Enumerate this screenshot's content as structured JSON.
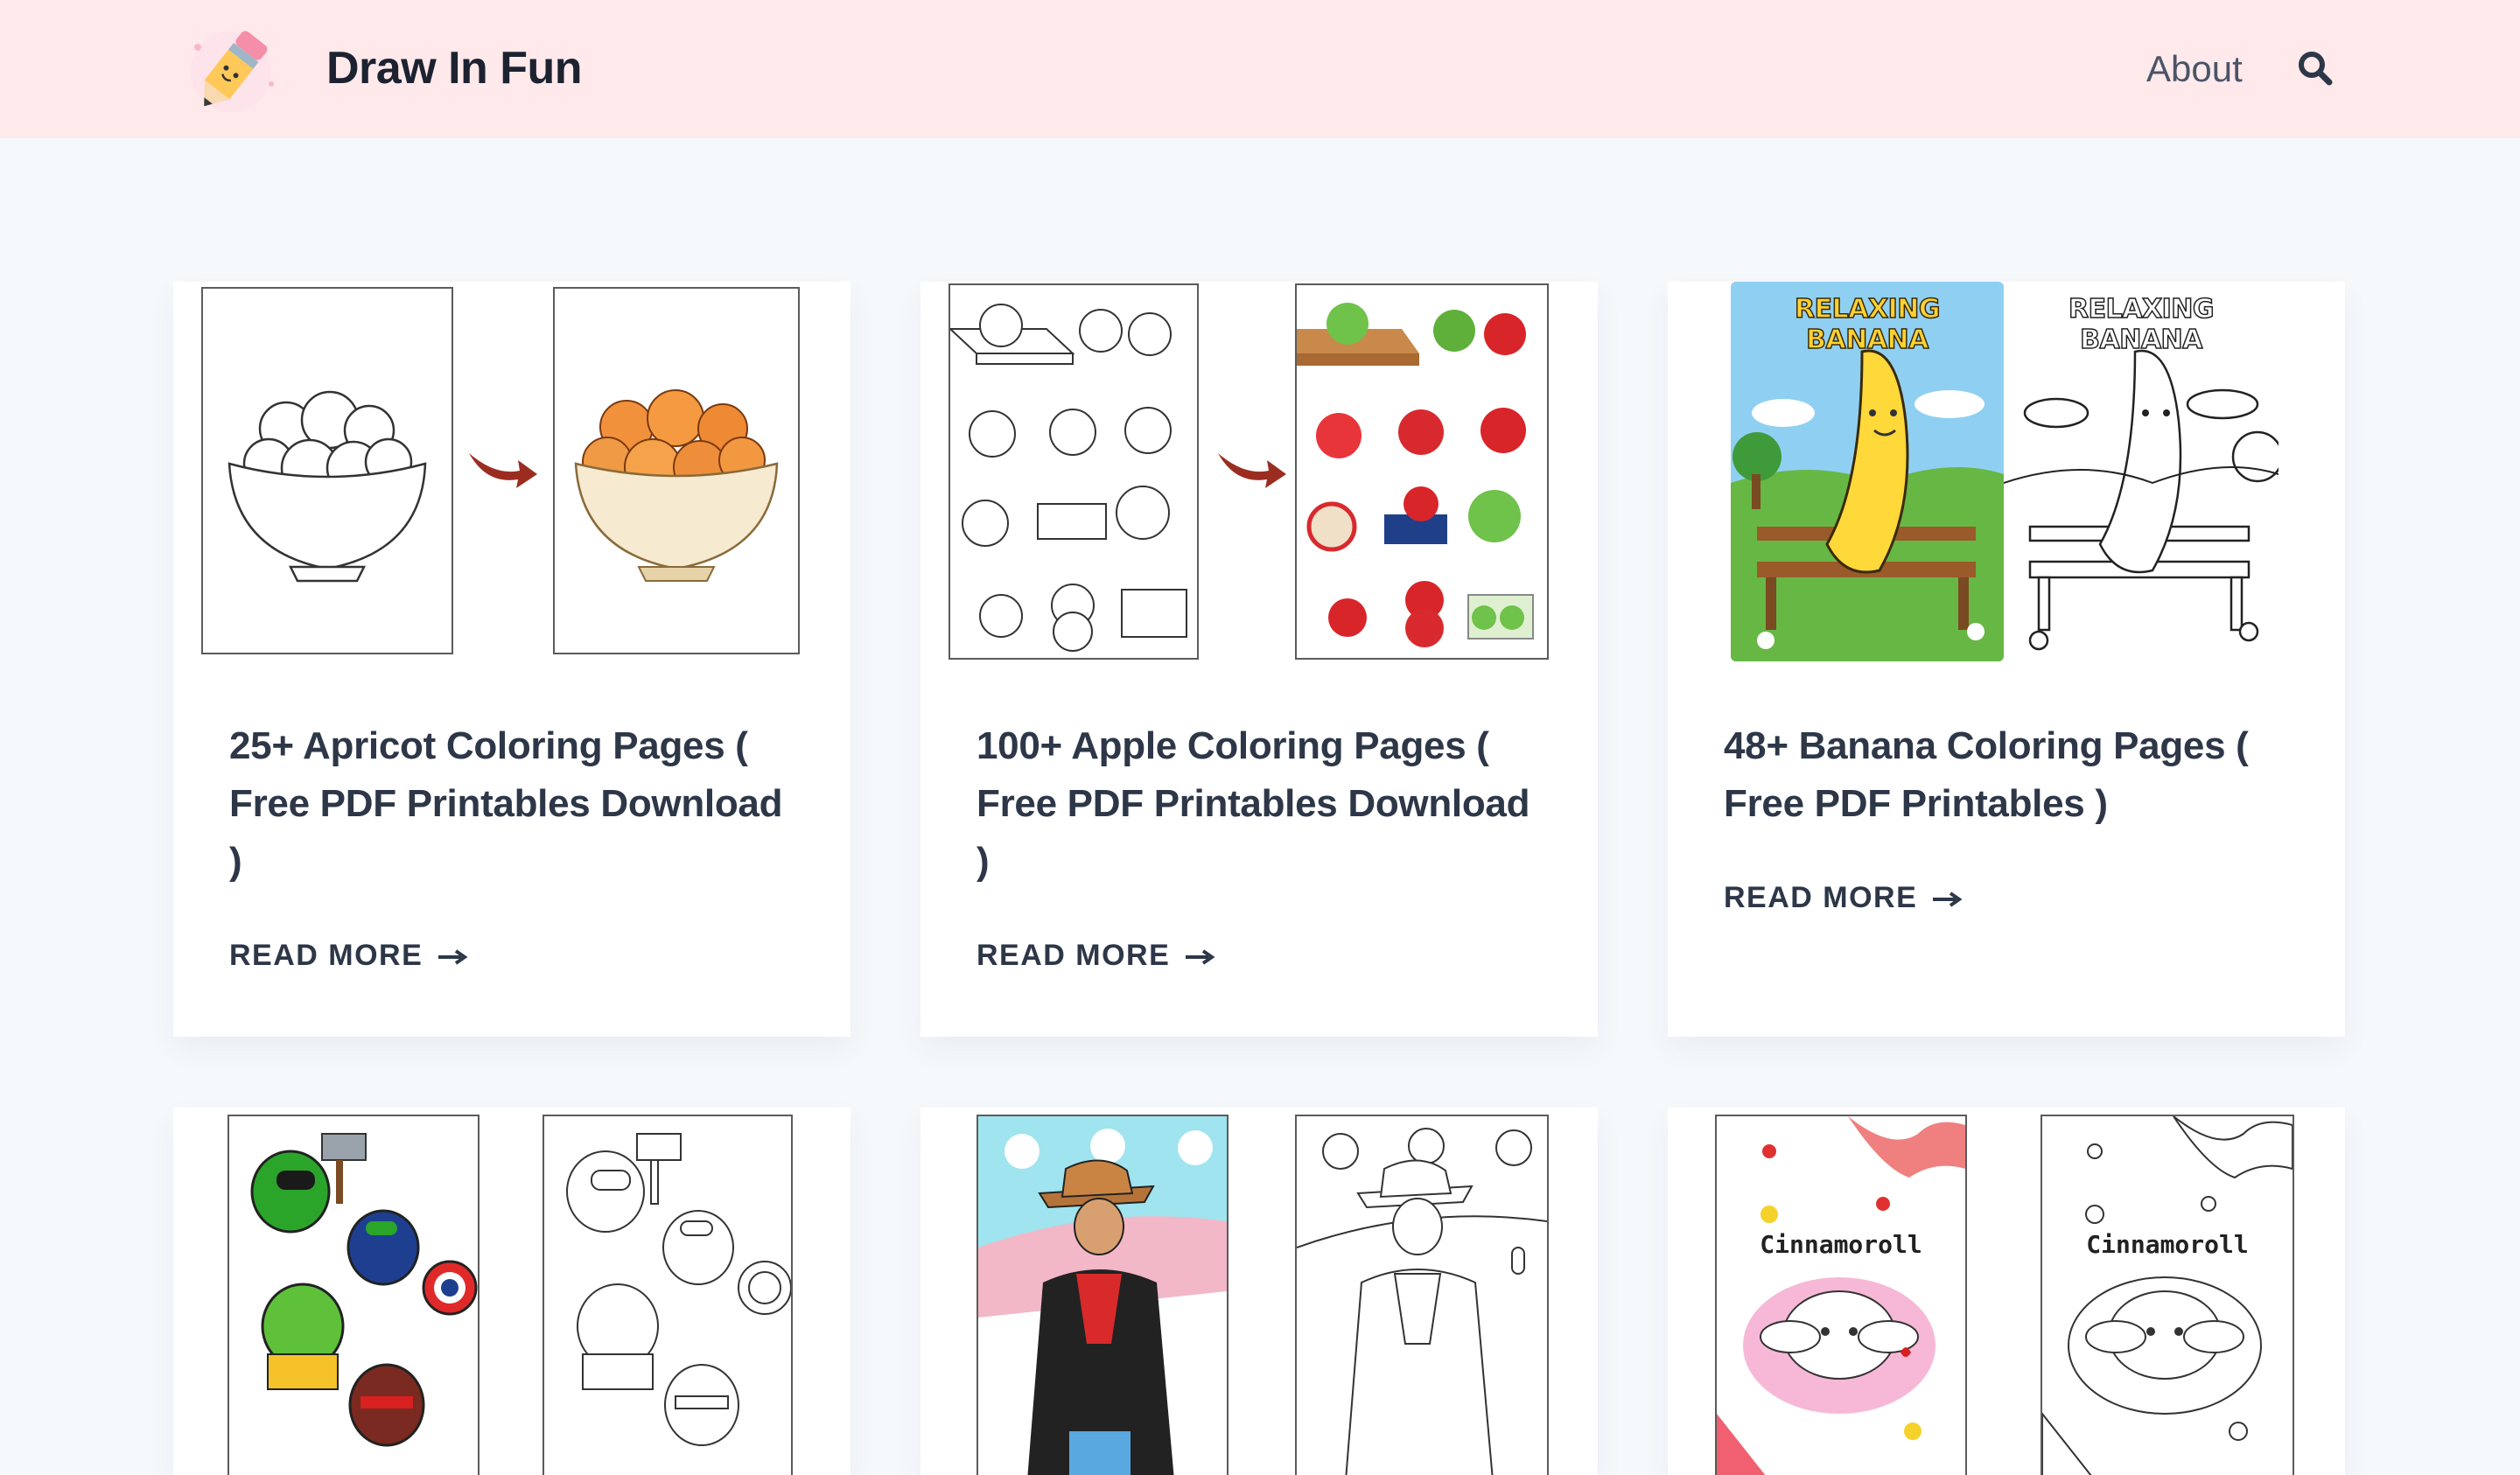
{
  "header": {
    "site_title": "Draw In Fun",
    "nav": [
      {
        "label": "About"
      }
    ],
    "search_icon": "search-icon"
  },
  "posts": [
    {
      "title": "25+ Apricot Coloring Pages ( Free PDF Printables Download )",
      "title_lines": [
        "25+ Apricot Coloring Pages (",
        "Free PDF Printables Download",
        ")"
      ],
      "read_more": "READ MORE"
    },
    {
      "title": "100+ Apple Coloring Pages ( Free PDF Printables Download )",
      "title_lines": [
        "100+ Apple Coloring Pages (",
        "Free PDF Printables Download",
        ")"
      ],
      "read_more": "READ MORE"
    },
    {
      "title": "48+ Banana Coloring Pages ( Free PDF Printables )",
      "title_lines": [
        "48+ Banana Coloring Pages (",
        "Free PDF Printables )"
      ],
      "read_more": "READ MORE",
      "image_text": [
        "RELAXING BANANA",
        "RELAXING BANANA"
      ]
    },
    {
      "title": "",
      "image_text": []
    },
    {
      "title": "",
      "image_text": []
    },
    {
      "title": "",
      "image_text": [
        "Cinnamoroll",
        "Cinnamoroll"
      ]
    }
  ],
  "colors": {
    "header_bg": "#ffe9ea",
    "page_bg": "#f6f9fc",
    "text": "#2d3748",
    "arrow_red": "#9b2d20"
  }
}
